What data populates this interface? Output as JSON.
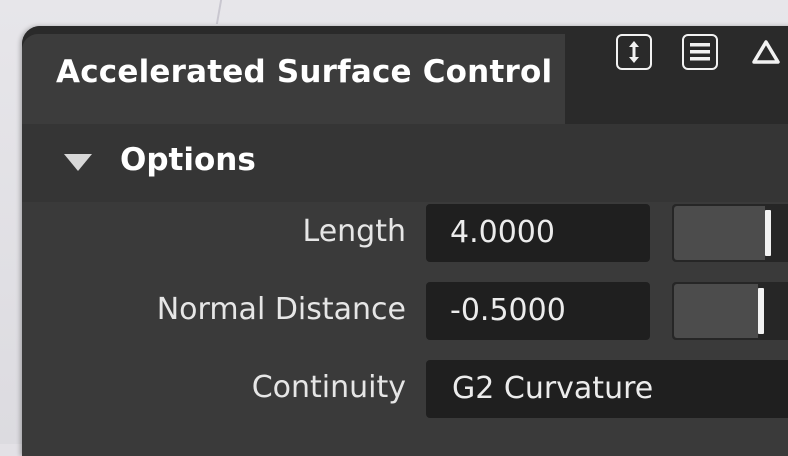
{
  "panel": {
    "title": "Accelerated Surface Control",
    "toolbar_icons": [
      "expand-vertical-icon",
      "menu-icon",
      "triangle-icon"
    ]
  },
  "options": {
    "section_label": "Options",
    "expanded": true,
    "length": {
      "label": "Length",
      "value": "4.0000",
      "slider_level": 0.67
    },
    "normal_distance": {
      "label": "Normal Distance",
      "value": "-0.5000",
      "slider_level": 0.62
    },
    "continuity": {
      "label": "Continuity",
      "value": "G2 Curvature"
    }
  },
  "colors": {
    "panel_bg": "#313131",
    "field_bg": "#1f1f1f",
    "text": "#ffffff"
  }
}
